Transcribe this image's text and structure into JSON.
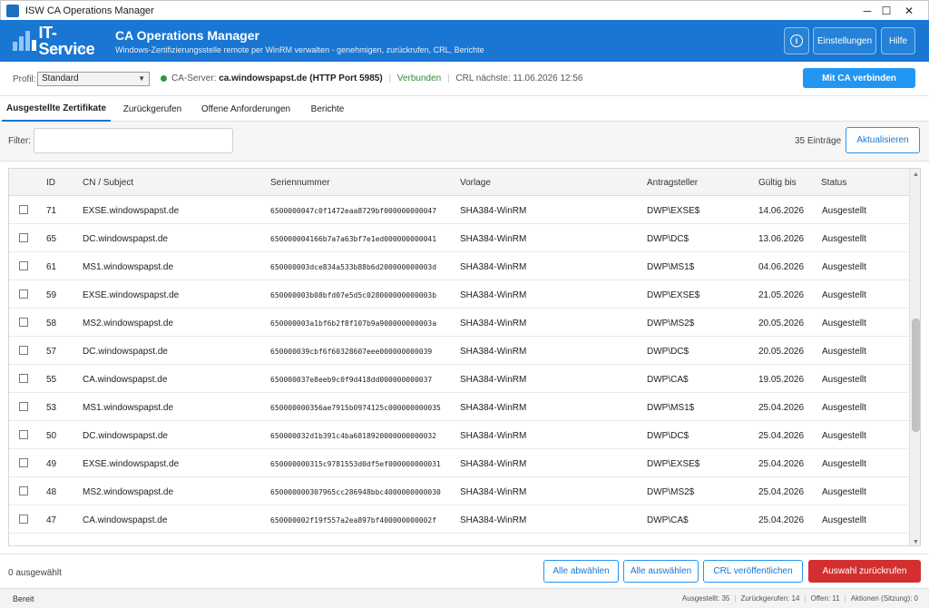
{
  "window": {
    "title": "ISW CA Operations Manager",
    "minimize": "─",
    "maximize": "☐",
    "close": "✕"
  },
  "header": {
    "logo_text": "IT-Service",
    "logo_sub": "WALTER",
    "title": "CA Operations Manager",
    "subtitle": "Windows-Zertifizierungsstelle remote per WinRM verwalten - genehmigen, zurückrufen, CRL, Berichte",
    "info_icon": "i",
    "settings_label": "Einstellungen",
    "help_label": "Hilfe"
  },
  "profile": {
    "label": "Profil:",
    "selected": "Standard",
    "ca_label": "CA-Server:",
    "ca_server": "ca.windowspapst.de",
    "port": "(HTTP Port 5985)",
    "connection_status": "Verbunden",
    "crl_next": "CRL nächste: 11.06.2026 12:56",
    "connect_label": "Mit CA verbinden",
    "status_color": "#2e9b3c"
  },
  "tabs": [
    {
      "label": "Ausgestellte Zertifikate",
      "active": true
    },
    {
      "label": "Zurückgerufen",
      "active": false
    },
    {
      "label": "Offene Anforderungen",
      "active": false
    },
    {
      "label": "Berichte",
      "active": false
    }
  ],
  "filter": {
    "label": "Filter:",
    "value": "",
    "count": "35 Einträge",
    "refresh_label": "Aktualisieren"
  },
  "table": {
    "columns": [
      "ID",
      "CN / Subject",
      "Seriennummer",
      "Vorlage",
      "Antragsteller",
      "Gültig bis",
      "Status"
    ],
    "rows": [
      {
        "id": "71",
        "cn": "EXSE.windowspapst.de",
        "serial": "6500000047c0f1472eaa8729bf000000000047",
        "template": "SHA384-WinRM",
        "requester": "DWP\\EXSE$",
        "valid_to": "14.06.2026",
        "status": "Ausgestellt"
      },
      {
        "id": "65",
        "cn": "DC.windowspapst.de",
        "serial": "650000004166b7a7a63bf7e1ed000000000041",
        "template": "SHA384-WinRM",
        "requester": "DWP\\DC$",
        "valid_to": "13.06.2026",
        "status": "Ausgestellt"
      },
      {
        "id": "61",
        "cn": "MS1.windowspapst.de",
        "serial": "650000003dce834a533b88b6d200000000003d",
        "template": "SHA384-WinRM",
        "requester": "DWP\\MS1$",
        "valid_to": "04.06.2026",
        "status": "Ausgestellt"
      },
      {
        "id": "59",
        "cn": "EXSE.windowspapst.de",
        "serial": "650000003b08bfd07e5d5c028000000000003b",
        "template": "SHA384-WinRM",
        "requester": "DWP\\EXSE$",
        "valid_to": "21.05.2026",
        "status": "Ausgestellt"
      },
      {
        "id": "58",
        "cn": "MS2.windowspapst.de",
        "serial": "650000003a1bf6b2f8f107b9a900000000003a",
        "template": "SHA384-WinRM",
        "requester": "DWP\\MS2$",
        "valid_to": "20.05.2026",
        "status": "Ausgestellt"
      },
      {
        "id": "57",
        "cn": "DC.windowspapst.de",
        "serial": "650000039cbf6f60328607eee000000000039",
        "template": "SHA384-WinRM",
        "requester": "DWP\\DC$",
        "valid_to": "20.05.2026",
        "status": "Ausgestellt"
      },
      {
        "id": "55",
        "cn": "CA.windowspapst.de",
        "serial": "650000037e8eeb9c0f9d418dd000000000037",
        "template": "SHA384-WinRM",
        "requester": "DWP\\CA$",
        "valid_to": "19.05.2026",
        "status": "Ausgestellt"
      },
      {
        "id": "53",
        "cn": "MS1.windowspapst.de",
        "serial": "650000000356ae7915b0974125c000000000035",
        "template": "SHA384-WinRM",
        "requester": "DWP\\MS1$",
        "valid_to": "25.04.2026",
        "status": "Ausgestellt"
      },
      {
        "id": "50",
        "cn": "DC.windowspapst.de",
        "serial": "650000032d1b391c4ba6818920000000000032",
        "template": "SHA384-WinRM",
        "requester": "DWP\\DC$",
        "valid_to": "25.04.2026",
        "status": "Ausgestellt"
      },
      {
        "id": "49",
        "cn": "EXSE.windowspapst.de",
        "serial": "650000000315c9781553d0df5ef000000000031",
        "template": "SHA384-WinRM",
        "requester": "DWP\\EXSE$",
        "valid_to": "25.04.2026",
        "status": "Ausgestellt"
      },
      {
        "id": "48",
        "cn": "MS2.windowspapst.de",
        "serial": "650000000307965cc286948bbc4000000000030",
        "template": "SHA384-WinRM",
        "requester": "DWP\\MS2$",
        "valid_to": "25.04.2026",
        "status": "Ausgestellt"
      },
      {
        "id": "47",
        "cn": "CA.windowspapst.de",
        "serial": "650000002f19f557a2ea897bf400000000002f",
        "template": "SHA384-WinRM",
        "requester": "DWP\\CA$",
        "valid_to": "25.04.2026",
        "status": "Ausgestellt"
      }
    ]
  },
  "actions": {
    "selected_count": "0 ausgewählt",
    "deselect_all": "Alle abwählen",
    "select_all": "Alle auswählen",
    "publish_crl": "CRL veröffentlichen",
    "revoke_selection": "Auswahl zurückrufen",
    "danger_color": "#d32f2f"
  },
  "statusbar": {
    "state": "Bereit",
    "issued": "Ausgestellt: 35",
    "revoked": "Zurückgerufen: 14",
    "open": "Offen: 11",
    "actions": "Aktionen (Sitzung): 0"
  }
}
